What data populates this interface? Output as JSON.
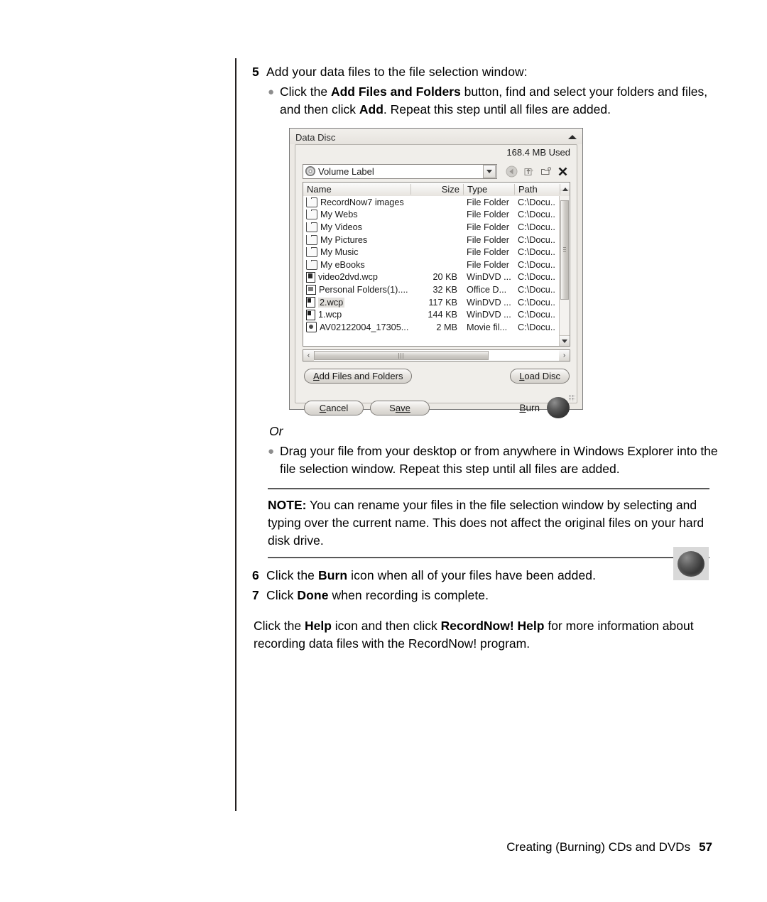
{
  "page": {
    "footer_text": "Creating (Burning) CDs and DVDs",
    "page_number": "57"
  },
  "steps": {
    "step5": {
      "number": "5",
      "text": "Add your data files to the file selection window:",
      "bullet_1": {
        "part1": "Click the ",
        "bold1": "Add Files and Folders",
        "part2": " button, find and select your folders and files, and then click ",
        "bold2": "Add",
        "part3": ". Repeat this step until all files are added."
      },
      "or_label": "Or",
      "bullet_2": "Drag your file from your desktop or from anywhere in Windows Explorer into the file selection window. Repeat this step until all files are added."
    },
    "note": {
      "label": "NOTE:",
      "text": " You can rename your files in the file selection window by selecting and typing over the current name. This does not affect the original files on your hard disk drive."
    },
    "step6": {
      "number": "6",
      "part1": "Click the ",
      "bold1": "Burn",
      "part2": " icon when all of your files have been added."
    },
    "step7": {
      "number": "7",
      "part1": "Click ",
      "bold1": "Done",
      "part2": " when recording is complete."
    },
    "closing": {
      "part1": "Click the ",
      "bold1": "Help",
      "part2": " icon and then click ",
      "bold2": "RecordNow! Help",
      "part3": " for more information about recording data files with the RecordNow! program."
    }
  },
  "dialog": {
    "title": "Data Disc",
    "used_label": "168.4 MB Used",
    "volume_label": "Volume Label",
    "toolbar_icons": [
      "back-icon",
      "up-folder-icon",
      "new-folder-icon",
      "delete-icon"
    ],
    "columns": [
      "Name",
      "Size",
      "Type",
      "Path"
    ],
    "files": [
      {
        "name": "RecordNow7 images",
        "size": "",
        "type": "File Folder",
        "path": "C:\\Docu..",
        "icon": "folder-icon",
        "selected": false
      },
      {
        "name": "My Webs",
        "size": "",
        "type": "File Folder",
        "path": "C:\\Docu..",
        "icon": "folder-icon",
        "selected": false
      },
      {
        "name": "My Videos",
        "size": "",
        "type": "File Folder",
        "path": "C:\\Docu..",
        "icon": "folder-icon",
        "selected": false
      },
      {
        "name": "My Pictures",
        "size": "",
        "type": "File Folder",
        "path": "C:\\Docu..",
        "icon": "folder-icon",
        "selected": false
      },
      {
        "name": "My Music",
        "size": "",
        "type": "File Folder",
        "path": "C:\\Docu..",
        "icon": "folder-icon",
        "selected": false
      },
      {
        "name": "My eBooks",
        "size": "",
        "type": "File Folder",
        "path": "C:\\Docu..",
        "icon": "folder-icon",
        "selected": false
      },
      {
        "name": "video2dvd.wcp",
        "size": "20 KB",
        "type": "WinDVD ...",
        "path": "C:\\Docu..",
        "icon": "document-icon",
        "selected": false
      },
      {
        "name": "Personal Folders(1)....",
        "size": "32 KB",
        "type": "Office D...",
        "path": "C:\\Docu..",
        "icon": "office-doc-icon",
        "selected": false
      },
      {
        "name": "2.wcp",
        "size": "117 KB",
        "type": "WinDVD ...",
        "path": "C:\\Docu..",
        "icon": "wcp-file-icon",
        "selected": true
      },
      {
        "name": "1.wcp",
        "size": "144 KB",
        "type": "WinDVD ...",
        "path": "C:\\Docu..",
        "icon": "wcp-file-icon",
        "selected": false
      },
      {
        "name": "AV02122004_17305...",
        "size": "2 MB",
        "type": "Movie fil...",
        "path": "C:\\Docu..",
        "icon": "movie-file-icon",
        "selected": false
      }
    ],
    "buttons": {
      "add_files_pre": "A",
      "add_files_post": "dd Files and Folders",
      "load_disc_pre": "L",
      "load_disc_post": "oad Disc",
      "cancel_pre": "C",
      "cancel_post": "ancel",
      "save_pre": "S",
      "save_mid": "ave",
      "burn_pre": "B",
      "burn_post": "urn"
    }
  },
  "colors": {
    "rule": "#595959",
    "dialog_bg": "#ece9e4",
    "burn_button": "#3b3b3b"
  }
}
